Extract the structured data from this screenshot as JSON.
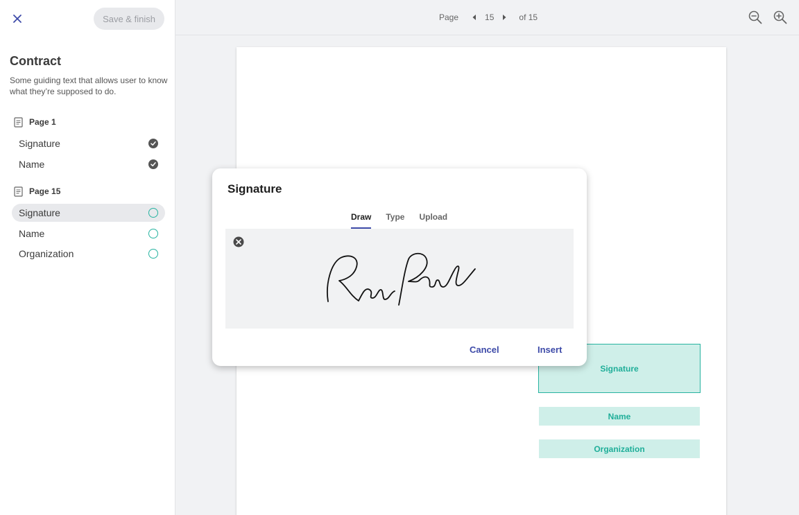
{
  "sidebar": {
    "save_label": "Save & finish",
    "title": "Contract",
    "description": "Some guiding text that allows user to know what they’re supposed to do.",
    "pages": [
      {
        "label": "Page 1",
        "fields": [
          {
            "label": "Signature",
            "status": "done"
          },
          {
            "label": "Name",
            "status": "done"
          }
        ]
      },
      {
        "label": "Page 15",
        "fields": [
          {
            "label": "Signature",
            "status": "pending"
          },
          {
            "label": "Name",
            "status": "pending"
          },
          {
            "label": "Organization",
            "status": "pending"
          }
        ]
      }
    ]
  },
  "topbar": {
    "page_label": "Page",
    "current_page": "15",
    "of_label": "of 15"
  },
  "document": {
    "fields": {
      "signature": "Signature",
      "name": "Name",
      "organization": "Organization"
    }
  },
  "modal": {
    "title": "Signature",
    "tabs": [
      "Draw",
      "Type",
      "Upload"
    ],
    "active_tab": "Draw",
    "cancel_label": "Cancel",
    "insert_label": "Insert"
  },
  "colors": {
    "accent": "#3d4aa8",
    "teal": "#26b3a0",
    "field_fill": "#cfefe9",
    "field_text": "#1fae99"
  },
  "icons": {
    "close": "close-icon",
    "page": "page-icon",
    "check_done": "check-circle-icon",
    "check_pending": "empty-circle-icon",
    "prev": "caret-left-icon",
    "next": "caret-right-icon",
    "zoom_out": "zoom-out-icon",
    "zoom_in": "zoom-in-icon",
    "clear": "clear-circle-icon"
  }
}
